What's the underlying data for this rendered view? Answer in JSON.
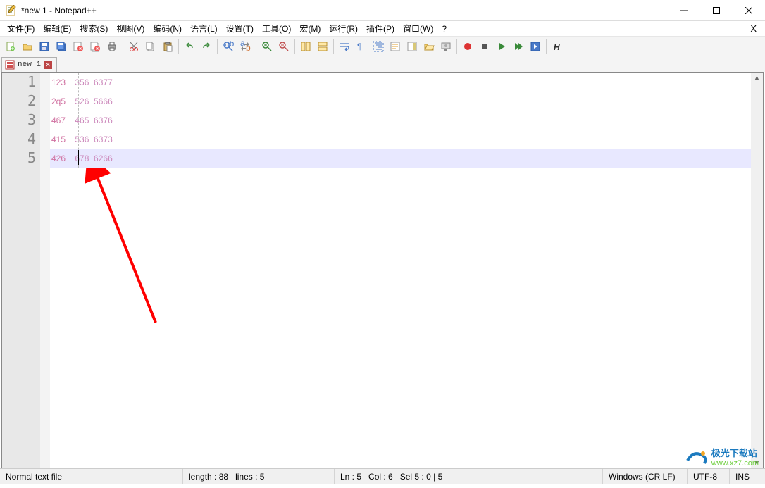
{
  "window": {
    "title": "*new 1 - Notepad++"
  },
  "menu": {
    "items": [
      "文件(F)",
      "编辑(E)",
      "搜索(S)",
      "视图(V)",
      "编码(N)",
      "语言(L)",
      "设置(T)",
      "工具(O)",
      "宏(M)",
      "运行(R)",
      "插件(P)",
      "窗口(W)",
      "?"
    ],
    "right": "X"
  },
  "tab": {
    "label": "new 1"
  },
  "editor": {
    "line_numbers": [
      "1",
      "2",
      "3",
      "4",
      "5"
    ],
    "lines": [
      {
        "lead": "123",
        "rest": "    356  6377"
      },
      {
        "lead": "2q5",
        "rest": "    526  5666"
      },
      {
        "lead": "467",
        "rest": "    465  6376"
      },
      {
        "lead": "415",
        "rest": "    536  6373"
      },
      {
        "lead": "426",
        "rest": "    678  6266"
      }
    ],
    "current_line_index": 4
  },
  "status": {
    "filetype": "Normal text file",
    "length": "length : 88",
    "lines": "lines : 5",
    "ln": "Ln : 5",
    "col": "Col : 6",
    "sel": "Sel 5 : 0 | 5",
    "eol": "Windows (CR LF)",
    "encoding": "UTF-8",
    "ins": "INS"
  },
  "watermark": {
    "brand": "极光下载站",
    "url": "www.xz7.com"
  },
  "toolbar_icons": [
    "new-file-icon",
    "open-file-icon",
    "save-icon",
    "save-all-icon",
    "close-icon",
    "close-all-icon",
    "print-icon",
    "sep",
    "cut-icon",
    "copy-icon",
    "paste-icon",
    "sep",
    "undo-icon",
    "redo-icon",
    "sep",
    "find-icon",
    "replace-icon",
    "sep",
    "zoom-in-icon",
    "zoom-out-icon",
    "sep",
    "sync-v-icon",
    "sync-h-icon",
    "sep",
    "wordwrap-icon",
    "all-chars-icon",
    "indent-guide-icon",
    "language-icon",
    "doc-map-icon",
    "folder-icon",
    "monitor-icon",
    "sep",
    "record-macro-icon",
    "stop-macro-icon",
    "play-macro-icon",
    "play-multi-icon",
    "save-macro-icon",
    "sep",
    "bold-h-icon"
  ]
}
